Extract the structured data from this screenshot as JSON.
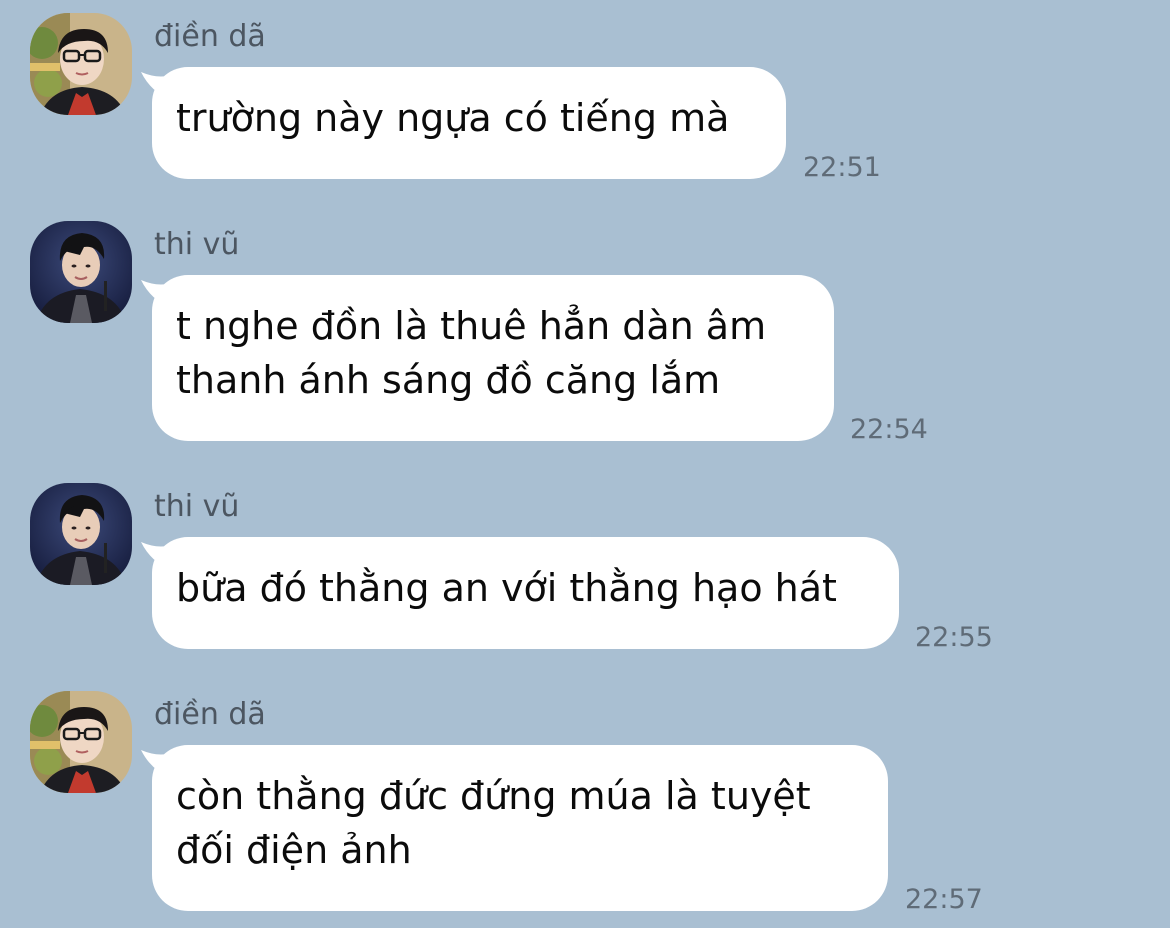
{
  "messages": [
    {
      "sender": "điền dã",
      "avatar": "avatar-dien-da",
      "text": "trường này ngựa có tiếng mà",
      "time": "22:51"
    },
    {
      "sender": "thi vũ",
      "avatar": "avatar-thi-vu",
      "text": "t nghe đồn là thuê hẳn dàn âm\nthanh ánh sáng đồ căng lắm",
      "time": "22:54"
    },
    {
      "sender": "thi vũ",
      "avatar": "avatar-thi-vu",
      "text": "bữa đó thằng an với thằng hạo hát",
      "time": "22:55"
    },
    {
      "sender": "điền dã",
      "avatar": "avatar-dien-da",
      "text": "còn thằng đức đứng múa là tuyệt\nđối điện ảnh",
      "time": "22:57"
    }
  ],
  "colors": {
    "background": "#a9bfd2",
    "bubble": "#ffffff",
    "sender_name": "#4c5661",
    "timestamp": "#5f6b77"
  }
}
